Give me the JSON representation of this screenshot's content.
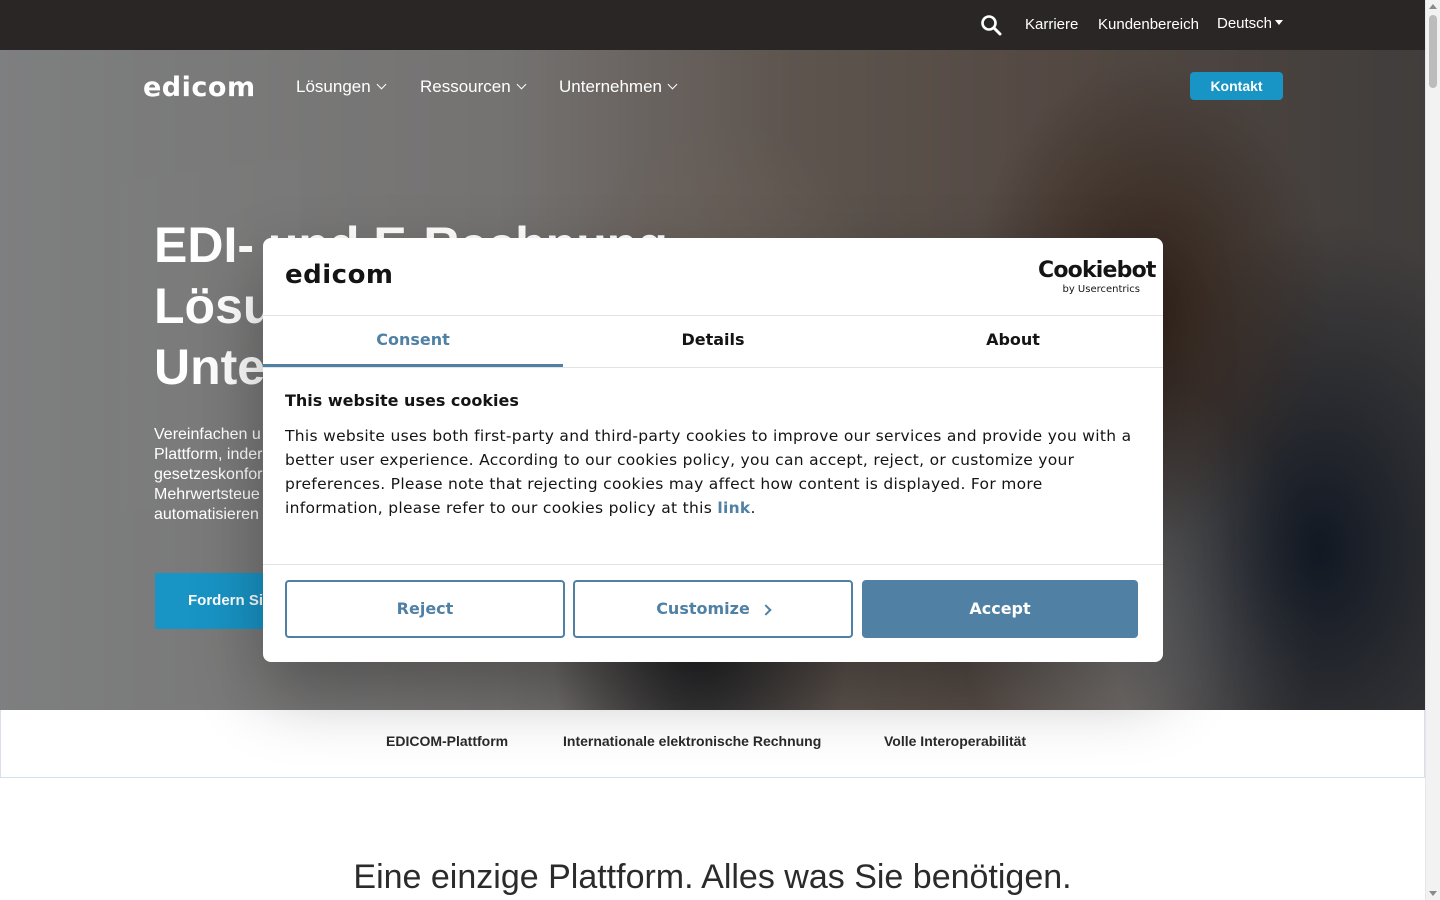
{
  "topbar": {
    "links": [
      {
        "label": "Karriere"
      },
      {
        "label": "Kundenbereich"
      },
      {
        "label": "Deutsch"
      }
    ]
  },
  "header": {
    "logo": "edicom",
    "nav": [
      {
        "label": "Lösungen"
      },
      {
        "label": "Ressourcen"
      },
      {
        "label": "Unternehmen"
      }
    ],
    "contact_button": "Kontakt"
  },
  "hero": {
    "title_lines": [
      "EDI- und E-Rechnung",
      "Lösu",
      "Unte"
    ],
    "subtitle_lines": [
      "Vereinfachen u",
      "Plattform, inder",
      "gesetzeskonfor",
      "Mehrwertsteue",
      "automatisieren"
    ],
    "cta": "Fordern Si"
  },
  "subnav": {
    "items": [
      {
        "label": "EDICOM-Plattform"
      },
      {
        "label": "Internationale elektronische Rechnung"
      },
      {
        "label": "Volle Interoperabilität"
      }
    ]
  },
  "section": {
    "title": "Eine einzige Plattform. Alles was Sie benötigen."
  },
  "cookie_dialog": {
    "logo": "edicom",
    "brand": "Cookiebot",
    "brand_sub": "by Usercentrics",
    "tabs": [
      {
        "label": "Consent",
        "active": true
      },
      {
        "label": "Details",
        "active": false
      },
      {
        "label": "About",
        "active": false
      }
    ],
    "heading": "This website uses cookies",
    "body": "This website uses both first-party and third-party cookies to improve our services and provide you with a better user experience. According to our cookies policy, you can accept, reject, or customize your preferences. Please note that rejecting cookies may affect how content is displayed. For more information, please refer to our cookies policy at this ",
    "link_text": "link",
    "body_end": ".",
    "buttons": {
      "reject": "Reject",
      "customize": "Customize",
      "accept": "Accept"
    }
  },
  "colors": {
    "topbar": "#2b2626",
    "brand_blue": "#1894c5",
    "cookie_accent": "#5081a4"
  }
}
